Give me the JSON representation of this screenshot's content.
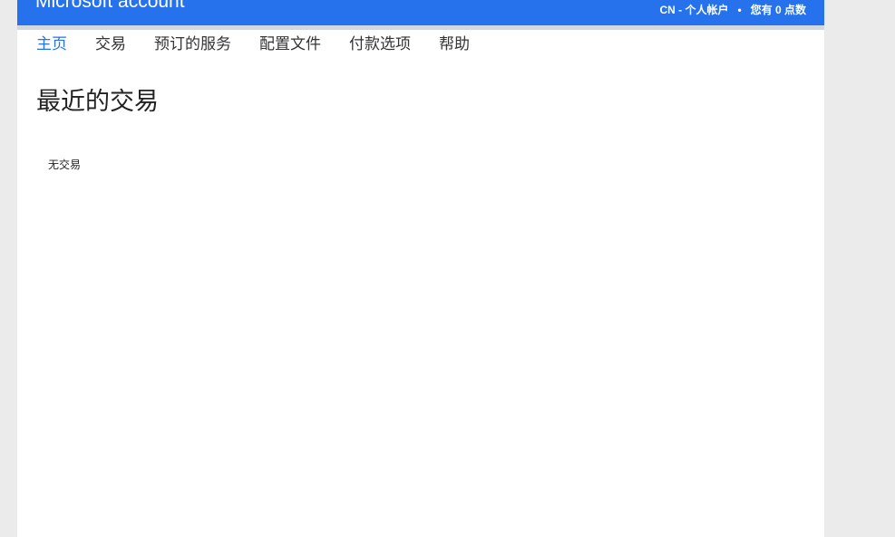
{
  "header": {
    "brand": "Microsoft account",
    "region_account": "CN - 个人帐户",
    "separator": "•",
    "points": "您有 0 点数"
  },
  "nav": {
    "items": [
      {
        "label": "主页",
        "active": true
      },
      {
        "label": "交易",
        "active": false
      },
      {
        "label": "预订的服务",
        "active": false
      },
      {
        "label": "配置文件",
        "active": false
      },
      {
        "label": "付款选项",
        "active": false
      },
      {
        "label": "帮助",
        "active": false
      }
    ]
  },
  "main": {
    "title": "最近的交易",
    "empty_message": "无交易"
  },
  "colors": {
    "header_blue": "#2672ec",
    "active_link": "#2672ec",
    "page_background": "#ebebeb"
  }
}
